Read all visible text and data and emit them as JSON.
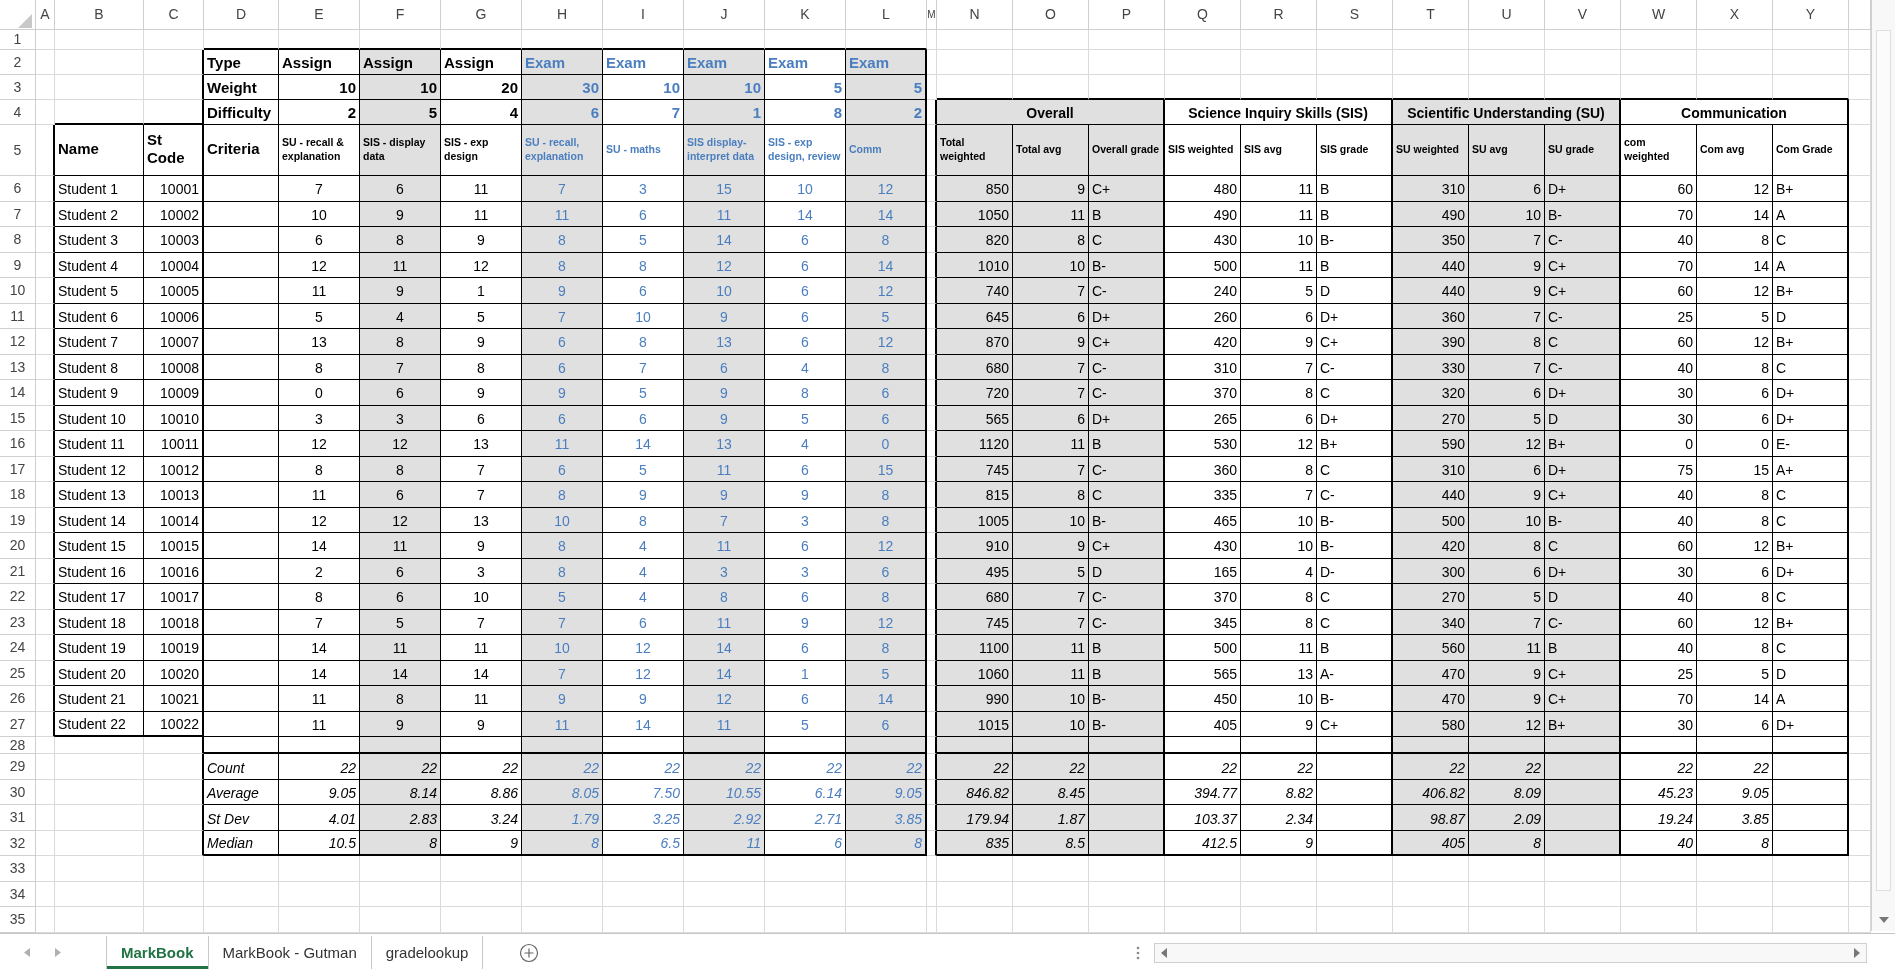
{
  "column_letters": [
    "A",
    "B",
    "C",
    "D",
    "E",
    "F",
    "G",
    "H",
    "I",
    "J",
    "K",
    "L",
    "M",
    "N",
    "O",
    "P",
    "Q",
    "R",
    "S",
    "T",
    "U",
    "V",
    "W",
    "X",
    "Y"
  ],
  "row_numbers": [
    "1",
    "2",
    "3",
    "4",
    "5",
    "6",
    "7",
    "8",
    "9",
    "10",
    "11",
    "12",
    "13",
    "14",
    "15",
    "16",
    "17",
    "18",
    "19",
    "20",
    "21",
    "22",
    "23",
    "24",
    "25",
    "26",
    "27",
    "28",
    "29",
    "30",
    "31",
    "32",
    "33",
    "34",
    "35"
  ],
  "assessment_table": {
    "row_labels": [
      "Type",
      "Weight",
      "Difficulty",
      "Criteria"
    ],
    "assessments": [
      {
        "kind": "assign",
        "type": "Assign",
        "weight": "10",
        "difficulty": "2",
        "criteria": "SU - recall & explanation"
      },
      {
        "kind": "assign",
        "type": "Assign",
        "weight": "10",
        "difficulty": "5",
        "criteria": "SIS - display data"
      },
      {
        "kind": "assign",
        "type": "Assign",
        "weight": "20",
        "difficulty": "4",
        "criteria": "SIS - exp design"
      },
      {
        "kind": "exam",
        "type": "Exam",
        "weight": "30",
        "difficulty": "6",
        "criteria": "SU - recall, explanation"
      },
      {
        "kind": "exam",
        "type": "Exam",
        "weight": "10",
        "difficulty": "7",
        "criteria": "SU - maths"
      },
      {
        "kind": "exam",
        "type": "Exam",
        "weight": "10",
        "difficulty": "1",
        "criteria": "SIS display-interpret data"
      },
      {
        "kind": "exam",
        "type": "Exam",
        "weight": "5",
        "difficulty": "8",
        "criteria": "SIS - exp design, review"
      },
      {
        "kind": "exam",
        "type": "Exam",
        "weight": "5",
        "difficulty": "2",
        "criteria": "Comm"
      }
    ]
  },
  "student_headers": [
    "Name",
    "St Code"
  ],
  "summary_groups": [
    {
      "title": "Overall",
      "columns": [
        "Total weighted",
        "Total avg",
        "Overall grade"
      ]
    },
    {
      "title": "Science Inquiry Skills (SIS)",
      "columns": [
        "SIS weighted",
        "SIS avg",
        "SIS grade"
      ]
    },
    {
      "title": "Scientific Understanding (SU)",
      "columns": [
        "SU weighted",
        "SU avg",
        "SU grade"
      ]
    },
    {
      "title": "Communication",
      "columns": [
        "com weighted",
        "Com avg",
        "Com Grade"
      ]
    }
  ],
  "students": [
    {
      "name": "Student 1",
      "code": "10001",
      "scores": [
        "7",
        "6",
        "11",
        "7",
        "3",
        "15",
        "10",
        "12"
      ],
      "summary": [
        "850",
        "9",
        "C+",
        "480",
        "11",
        "B",
        "310",
        "6",
        "D+",
        "60",
        "12",
        "B+"
      ]
    },
    {
      "name": "Student 2",
      "code": "10002",
      "scores": [
        "10",
        "9",
        "11",
        "11",
        "6",
        "11",
        "14",
        "14"
      ],
      "summary": [
        "1050",
        "11",
        "B",
        "490",
        "11",
        "B",
        "490",
        "10",
        "B-",
        "70",
        "14",
        "A"
      ]
    },
    {
      "name": "Student 3",
      "code": "10003",
      "scores": [
        "6",
        "8",
        "9",
        "8",
        "5",
        "14",
        "6",
        "8"
      ],
      "summary": [
        "820",
        "8",
        "C",
        "430",
        "10",
        "B-",
        "350",
        "7",
        "C-",
        "40",
        "8",
        "C"
      ]
    },
    {
      "name": "Student 4",
      "code": "10004",
      "scores": [
        "12",
        "11",
        "12",
        "8",
        "8",
        "12",
        "6",
        "14"
      ],
      "summary": [
        "1010",
        "10",
        "B-",
        "500",
        "11",
        "B",
        "440",
        "9",
        "C+",
        "70",
        "14",
        "A"
      ]
    },
    {
      "name": "Student 5",
      "code": "10005",
      "scores": [
        "11",
        "9",
        "1",
        "9",
        "6",
        "10",
        "6",
        "12"
      ],
      "summary": [
        "740",
        "7",
        "C-",
        "240",
        "5",
        "D",
        "440",
        "9",
        "C+",
        "60",
        "12",
        "B+"
      ]
    },
    {
      "name": "Student 6",
      "code": "10006",
      "scores": [
        "5",
        "4",
        "5",
        "7",
        "10",
        "9",
        "6",
        "5"
      ],
      "summary": [
        "645",
        "6",
        "D+",
        "260",
        "6",
        "D+",
        "360",
        "7",
        "C-",
        "25",
        "5",
        "D"
      ]
    },
    {
      "name": "Student 7",
      "code": "10007",
      "scores": [
        "13",
        "8",
        "9",
        "6",
        "8",
        "13",
        "6",
        "12"
      ],
      "summary": [
        "870",
        "9",
        "C+",
        "420",
        "9",
        "C+",
        "390",
        "8",
        "C",
        "60",
        "12",
        "B+"
      ]
    },
    {
      "name": "Student 8",
      "code": "10008",
      "scores": [
        "8",
        "7",
        "8",
        "6",
        "7",
        "6",
        "4",
        "8"
      ],
      "summary": [
        "680",
        "7",
        "C-",
        "310",
        "7",
        "C-",
        "330",
        "7",
        "C-",
        "40",
        "8",
        "C"
      ]
    },
    {
      "name": "Student 9",
      "code": "10009",
      "scores": [
        "0",
        "6",
        "9",
        "9",
        "5",
        "9",
        "8",
        "6"
      ],
      "summary": [
        "720",
        "7",
        "C-",
        "370",
        "8",
        "C",
        "320",
        "6",
        "D+",
        "30",
        "6",
        "D+"
      ]
    },
    {
      "name": "Student 10",
      "code": "10010",
      "scores": [
        "3",
        "3",
        "6",
        "6",
        "6",
        "9",
        "5",
        "6"
      ],
      "summary": [
        "565",
        "6",
        "D+",
        "265",
        "6",
        "D+",
        "270",
        "5",
        "D",
        "30",
        "6",
        "D+"
      ]
    },
    {
      "name": "Student 11",
      "code": "10011",
      "scores": [
        "12",
        "12",
        "13",
        "11",
        "14",
        "13",
        "4",
        "0"
      ],
      "summary": [
        "1120",
        "11",
        "B",
        "530",
        "12",
        "B+",
        "590",
        "12",
        "B+",
        "0",
        "0",
        "E-"
      ]
    },
    {
      "name": "Student 12",
      "code": "10012",
      "scores": [
        "8",
        "8",
        "7",
        "6",
        "5",
        "11",
        "6",
        "15"
      ],
      "summary": [
        "745",
        "7",
        "C-",
        "360",
        "8",
        "C",
        "310",
        "6",
        "D+",
        "75",
        "15",
        "A+"
      ]
    },
    {
      "name": "Student 13",
      "code": "10013",
      "scores": [
        "11",
        "6",
        "7",
        "8",
        "9",
        "9",
        "9",
        "8"
      ],
      "summary": [
        "815",
        "8",
        "C",
        "335",
        "7",
        "C-",
        "440",
        "9",
        "C+",
        "40",
        "8",
        "C"
      ]
    },
    {
      "name": "Student 14",
      "code": "10014",
      "scores": [
        "12",
        "12",
        "13",
        "10",
        "8",
        "7",
        "3",
        "8"
      ],
      "summary": [
        "1005",
        "10",
        "B-",
        "465",
        "10",
        "B-",
        "500",
        "10",
        "B-",
        "40",
        "8",
        "C"
      ]
    },
    {
      "name": "Student 15",
      "code": "10015",
      "scores": [
        "14",
        "11",
        "9",
        "8",
        "4",
        "11",
        "6",
        "12"
      ],
      "summary": [
        "910",
        "9",
        "C+",
        "430",
        "10",
        "B-",
        "420",
        "8",
        "C",
        "60",
        "12",
        "B+"
      ]
    },
    {
      "name": "Student 16",
      "code": "10016",
      "scores": [
        "2",
        "6",
        "3",
        "8",
        "4",
        "3",
        "3",
        "6"
      ],
      "summary": [
        "495",
        "5",
        "D",
        "165",
        "4",
        "D-",
        "300",
        "6",
        "D+",
        "30",
        "6",
        "D+"
      ]
    },
    {
      "name": "Student 17",
      "code": "10017",
      "scores": [
        "8",
        "6",
        "10",
        "5",
        "4",
        "8",
        "6",
        "8"
      ],
      "summary": [
        "680",
        "7",
        "C-",
        "370",
        "8",
        "C",
        "270",
        "5",
        "D",
        "40",
        "8",
        "C"
      ]
    },
    {
      "name": "Student 18",
      "code": "10018",
      "scores": [
        "7",
        "5",
        "7",
        "7",
        "6",
        "11",
        "9",
        "12"
      ],
      "summary": [
        "745",
        "7",
        "C-",
        "345",
        "8",
        "C",
        "340",
        "7",
        "C-",
        "60",
        "12",
        "B+"
      ]
    },
    {
      "name": "Student 19",
      "code": "10019",
      "scores": [
        "14",
        "11",
        "11",
        "10",
        "12",
        "14",
        "6",
        "8"
      ],
      "summary": [
        "1100",
        "11",
        "B",
        "500",
        "11",
        "B",
        "560",
        "11",
        "B",
        "40",
        "8",
        "C"
      ]
    },
    {
      "name": "Student 20",
      "code": "10020",
      "scores": [
        "14",
        "14",
        "14",
        "7",
        "12",
        "14",
        "1",
        "5"
      ],
      "summary": [
        "1060",
        "11",
        "B",
        "565",
        "13",
        "A-",
        "470",
        "9",
        "C+",
        "25",
        "5",
        "D"
      ]
    },
    {
      "name": "Student 21",
      "code": "10021",
      "scores": [
        "11",
        "8",
        "11",
        "9",
        "9",
        "12",
        "6",
        "14"
      ],
      "summary": [
        "990",
        "10",
        "B-",
        "450",
        "10",
        "B-",
        "470",
        "9",
        "C+",
        "70",
        "14",
        "A"
      ]
    },
    {
      "name": "Student 22",
      "code": "10022",
      "scores": [
        "11",
        "9",
        "9",
        "11",
        "14",
        "11",
        "5",
        "6"
      ],
      "summary": [
        "1015",
        "10",
        "B-",
        "405",
        "9",
        "C+",
        "580",
        "12",
        "B+",
        "30",
        "6",
        "D+"
      ]
    }
  ],
  "statistics": [
    {
      "label": "Count",
      "scores": [
        "22",
        "22",
        "22",
        "22",
        "22",
        "22",
        "22",
        "22"
      ],
      "summary": [
        "22",
        "22",
        "22",
        "22",
        "22",
        "22",
        "22",
        "22"
      ]
    },
    {
      "label": "Average",
      "scores": [
        "9.05",
        "8.14",
        "8.86",
        "8.05",
        "7.50",
        "10.55",
        "6.14",
        "9.05"
      ],
      "summary": [
        "846.82",
        "8.45",
        "394.77",
        "8.82",
        "406.82",
        "8.09",
        "45.23",
        "9.05"
      ]
    },
    {
      "label": "St Dev",
      "scores": [
        "4.01",
        "2.83",
        "3.24",
        "1.79",
        "3.25",
        "2.92",
        "2.71",
        "3.85"
      ],
      "summary": [
        "179.94",
        "1.87",
        "103.37",
        "2.34",
        "98.87",
        "2.09",
        "19.24",
        "3.85"
      ]
    },
    {
      "label": "Median",
      "scores": [
        "10.5",
        "8",
        "9",
        "8",
        "6.5",
        "11",
        "6",
        "8"
      ],
      "summary": [
        "835",
        "8.5",
        "412.5",
        "9",
        "405",
        "8",
        "40",
        "8"
      ]
    }
  ],
  "sheet_tabs": [
    {
      "label": "MarkBook",
      "selected": true
    },
    {
      "label": "MarkBook - Gutman",
      "selected": false
    },
    {
      "label": "gradelookup",
      "selected": false
    }
  ]
}
